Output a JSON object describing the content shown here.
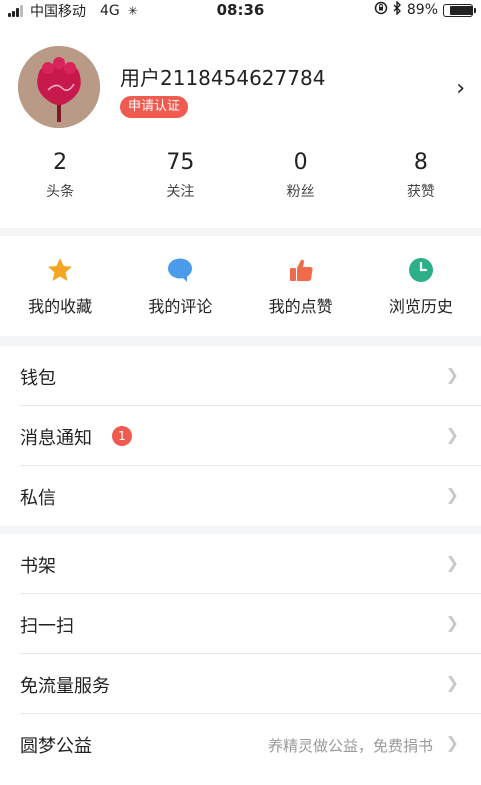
{
  "status_bar": {
    "carrier": "中国移动",
    "network": "4G",
    "time": "08:36",
    "battery_percent": "89%",
    "battery_level": 0.89
  },
  "profile": {
    "username": "用户2118454627784",
    "verify_label": "申请认证",
    "arrow": "›"
  },
  "stats": [
    {
      "value": "2",
      "label": "头条"
    },
    {
      "value": "75",
      "label": "关注"
    },
    {
      "value": "0",
      "label": "粉丝"
    },
    {
      "value": "8",
      "label": "获赞"
    }
  ],
  "shortcuts": [
    {
      "label": "我的收藏",
      "icon": "star-icon",
      "color": "#f5a623"
    },
    {
      "label": "我的评论",
      "icon": "comment-icon",
      "color": "#4a9bea"
    },
    {
      "label": "我的点赞",
      "icon": "thumb-up-icon",
      "color": "#f06b4a"
    },
    {
      "label": "浏览历史",
      "icon": "clock-icon",
      "color": "#2bb08a"
    }
  ],
  "menu_group_1": [
    {
      "label": "钱包"
    },
    {
      "label": "消息通知",
      "badge": "1"
    },
    {
      "label": "私信"
    }
  ],
  "menu_group_2": [
    {
      "label": "书架"
    },
    {
      "label": "扫一扫"
    },
    {
      "label": "免流量服务"
    },
    {
      "label": "圆梦公益",
      "hint": "养精灵做公益，免费捐书"
    }
  ],
  "chevron": "❯"
}
